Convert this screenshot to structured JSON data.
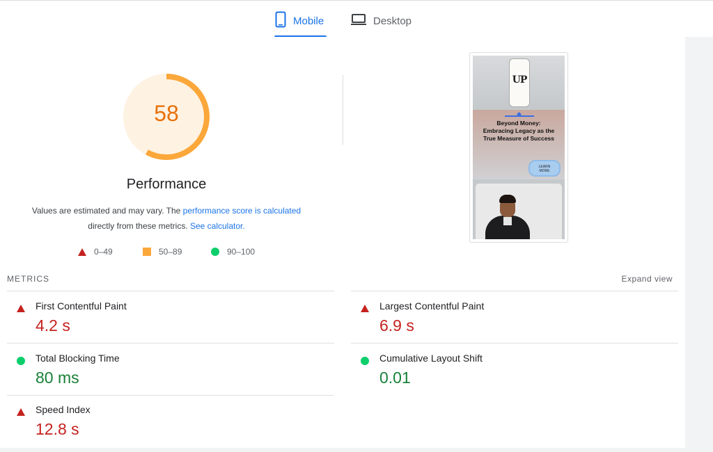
{
  "tabs": [
    {
      "label": "Mobile",
      "icon": "smartphone-icon",
      "active": true
    },
    {
      "label": "Desktop",
      "icon": "laptop-icon",
      "active": false
    }
  ],
  "gauge": {
    "score": "58",
    "fraction": 0.58,
    "color": "#fba73a",
    "bg": "#fef2e2"
  },
  "performance": {
    "title": "Performance",
    "desc_1": "Values are estimated and may vary. The ",
    "desc_link_1": "performance score is calculated",
    "desc_2": "directly from these metrics. ",
    "desc_link_2": "See calculator."
  },
  "legend": [
    {
      "shape": "triangle",
      "color": "#c5221f",
      "label": "0–49"
    },
    {
      "shape": "square",
      "color": "#fba73a",
      "label": "50–89"
    },
    {
      "shape": "circle",
      "color": "#0cce6b",
      "label": "90–100"
    }
  ],
  "screenshot": {
    "logo": "UP",
    "headline_1": "Beyond Money:",
    "headline_2": "Embracing Legacy as the",
    "headline_3": "True Measure of Success",
    "button_1": "LEARN",
    "button_2": "MORE"
  },
  "metrics": {
    "section_label": "METRICS",
    "expand": "Expand view",
    "fcp": {
      "name": "First Contentful Paint",
      "value": "4.2 s",
      "status": "fail"
    },
    "lcp": {
      "name": "Largest Contentful Paint",
      "value": "6.9 s",
      "status": "fail"
    },
    "tbt": {
      "name": "Total Blocking Time",
      "value": "80 ms",
      "status": "pass"
    },
    "cls": {
      "name": "Cumulative Layout Shift",
      "value": "0.01",
      "status": "pass"
    },
    "si": {
      "name": "Speed Index",
      "value": "12.8 s",
      "status": "fail"
    }
  },
  "colors": {
    "accent": "#1a73e8",
    "fail": "#c5221f",
    "average": "#fba73a",
    "pass": "#0cce6b",
    "pass_text": "#188038"
  }
}
